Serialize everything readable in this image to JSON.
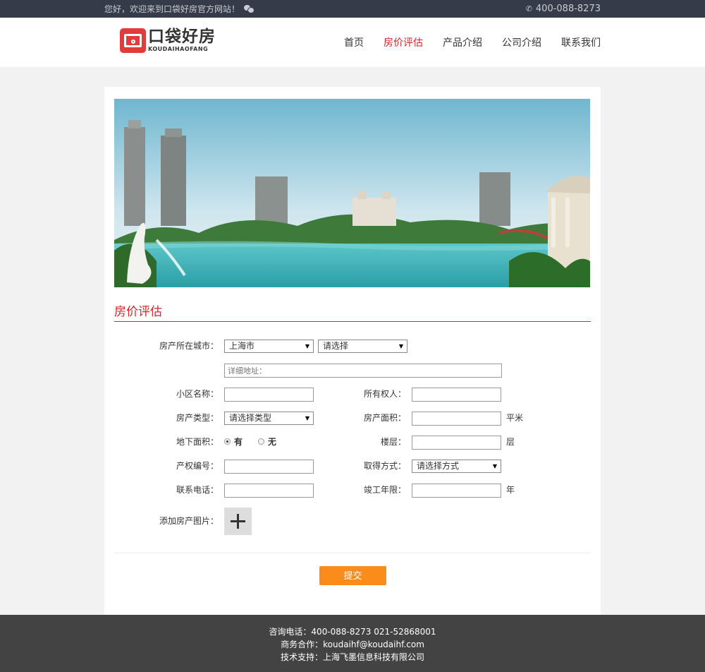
{
  "topbar": {
    "welcome": "您好，欢迎来到口袋好房官方网站！",
    "phone": "400-088-8273"
  },
  "logo": {
    "cn": "口袋好房",
    "en": "KOUDAIHAOFANG"
  },
  "nav": {
    "items": [
      {
        "label": "首页",
        "active": false
      },
      {
        "label": "房价评估",
        "active": true
      },
      {
        "label": "产品介绍",
        "active": false
      },
      {
        "label": "公司介绍",
        "active": false
      },
      {
        "label": "联系我们",
        "active": false
      }
    ]
  },
  "section": {
    "title": "房价评估"
  },
  "form": {
    "city_label": "房产所在城市：",
    "city_value": "上海市",
    "district_value": "请选择",
    "address_placeholder": "详细地址：",
    "community_label": "小区名称：",
    "owner_label": "所有权人：",
    "type_label": "房产类型：",
    "type_value": "请选择类型",
    "area_label": "房产面积：",
    "area_unit": "平米",
    "basement_label": "地下面积：",
    "basement_yes": "有",
    "basement_no": "无",
    "floor_label": "楼层：",
    "floor_unit": "层",
    "cert_label": "产权编号：",
    "acquire_label": "取得方式：",
    "acquire_value": "请选择方式",
    "phone_label": "联系电话：",
    "year_label": "竣工年限：",
    "year_unit": "年",
    "photo_label": "添加房产图片：",
    "submit_label": "提交"
  },
  "footer": {
    "line1": "咨询电话：400-088-8273 021-52868001",
    "line2": "商务合作：koudaihf@koudaihf.com",
    "line3": "技术支持：上海飞墨信息科技有限公司"
  },
  "colors": {
    "accent": "#d9242c",
    "submit": "#fb8c19",
    "topbar": "#353b48",
    "footer": "#434343"
  }
}
